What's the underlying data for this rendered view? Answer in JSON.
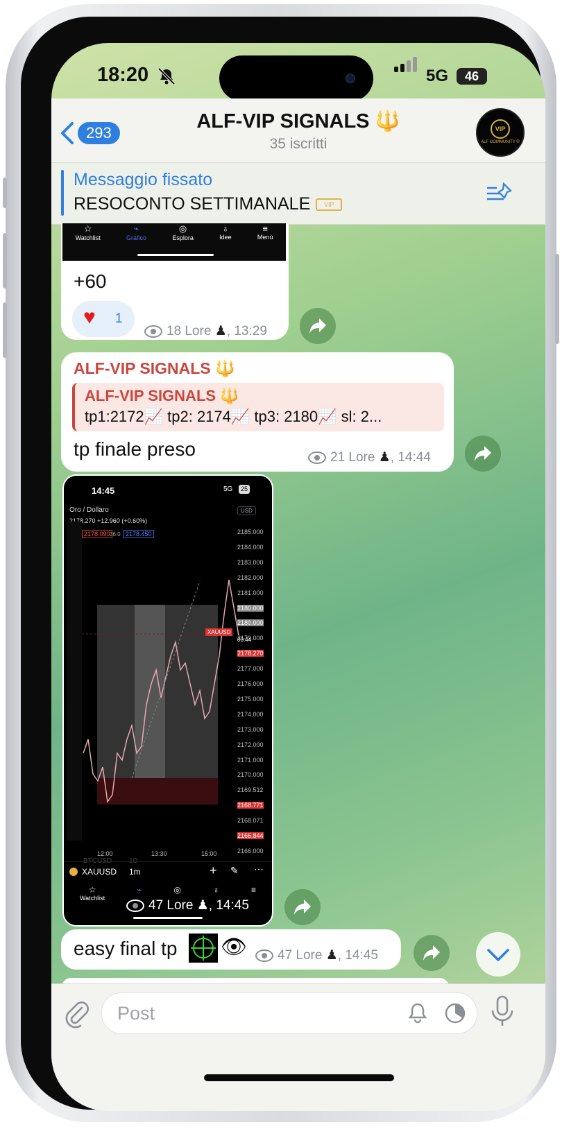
{
  "status": {
    "time": "18:20",
    "network": "5G",
    "battery": "46"
  },
  "header": {
    "back_count": "293",
    "title": "ALF-VIP SIGNALS 🔱",
    "subtitle": "35 iscritti",
    "avatar_text": "VIP",
    "avatar_caption": "ALF COMMUNITY ®"
  },
  "pinned": {
    "label": "Messaggio fissato",
    "text": "RESOCONTO SETTIMANALE"
  },
  "nav_labels": [
    "Watchlist",
    "Grafico",
    "Esplora",
    "Idee",
    "Menù"
  ],
  "messages": [
    {
      "text": "+60",
      "reaction": {
        "emoji": "❤️",
        "count": "1"
      },
      "views": "18",
      "author": "Lore",
      "time": ", 13:29"
    },
    {
      "sender": "ALF-VIP SIGNALS 🔱",
      "quote_sender": "ALF-VIP SIGNALS 🔱",
      "quote_text": "tp1:2172📈 tp2: 2174📈 tp3: 2180📈 sl: 2...",
      "text": "tp finale preso",
      "views": "21",
      "author": "Lore",
      "time": ", 14:44"
    },
    {
      "photo": {
        "time": "14:45",
        "network": "5G",
        "battery": "25",
        "symbol_name": "Oro / Dollaro",
        "quote_line": "2178.270 +12.960 (+0.60%)",
        "sell_price": "2178.090",
        "spread": "36.0",
        "buy_price": "2178.450",
        "currency": "USD",
        "price_axis": [
          "2185.000",
          "2184.000",
          "2183.000",
          "2182.000",
          "2181.000",
          "2180.000",
          "2180.000",
          "2179.000",
          "2178.270",
          "2177.000",
          "2176.000",
          "2175.000",
          "2174.000",
          "2173.000",
          "2172.000",
          "2171.000",
          "2170.000",
          "2169.512",
          "2168.771",
          "2168.071",
          "2166.844",
          "2166.000"
        ],
        "price_label_symbol": "XAUUSD",
        "price_label_countdown": "00:44",
        "time_axis": [
          "12:00",
          "13:30",
          "15:00"
        ],
        "ticker": "XAUUSD",
        "interval": "1m",
        "ghost_ticker": "BTCUSD",
        "ghost_interval": "1D"
      },
      "views": "47",
      "author": "Lore",
      "time": ", 14:45"
    },
    {
      "text": "easy final tp",
      "emojis": "🎯👁️",
      "views": "47",
      "author": "Lore",
      "time": ", 14:45"
    }
  ],
  "input": {
    "placeholder": "Post"
  }
}
